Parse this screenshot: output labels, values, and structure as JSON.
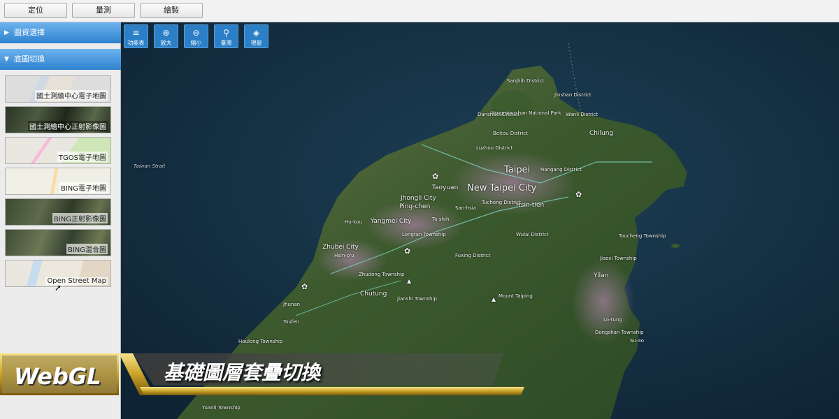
{
  "toolbar": {
    "buttons": [
      "定位",
      "量測",
      "繪製"
    ]
  },
  "sidebar": {
    "panel1": "圖資選擇",
    "panel2": "底圖切換",
    "basemaps": [
      "國土測繪中心電子地圖",
      "國土測繪中心正射影像圖",
      "TGOS電子地圖",
      "BING電子地圖",
      "BING正射影像圖",
      "BING混合圖",
      "Open Street Map"
    ]
  },
  "map_tools": [
    {
      "label": "功能表",
      "icon": "menu-icon"
    },
    {
      "label": "放大",
      "icon": "zoom-in-icon"
    },
    {
      "label": "縮小",
      "icon": "zoom-out-icon"
    },
    {
      "label": "臺灣",
      "icon": "location-pin-icon"
    },
    {
      "label": "視窗",
      "icon": "layers-icon"
    }
  ],
  "map_labels": {
    "sea": "Taiwan Strait",
    "new_taipei": "New Taipei City",
    "taipei": "Taipei",
    "keelung": "Chilung",
    "taoyuan": "Taoyuan",
    "jhongli": "Jhongli City",
    "pingzhen": "Ping-chen",
    "yangmei": "Yangmei City",
    "hukou": "Hu-kou",
    "zhubei": "Zhubei City",
    "hsinpu": "Hsin-p'u",
    "zhudong": "Zhudong Township",
    "chutung": "Chutung",
    "longtan": "Longtan Township",
    "daxi": "Ta-shih",
    "luzhou": "Luzhou District",
    "tamsui": "Danshuei District",
    "beitou": "Beitou District",
    "sanchih": "Sanjhih District",
    "jinshan": "Jinshan District",
    "wanli": "Wanli District",
    "nangang": "Nangang District",
    "xindian": "Hsin-tien",
    "tucheng": "Tucheng District",
    "sanxia": "San-hsia",
    "toucheng": "Toucheng Township",
    "jiaoxi": "Jiaoxi Township",
    "yilan": "Yilan",
    "luodong": "Lo-tung",
    "suao": "Su-ao",
    "dongshan": "Dongshan Township",
    "mt_taiping": "Mount Taiping",
    "wulai": "Wulai District",
    "fuxing": "Fuxing District",
    "jianshi": "Jianshi Township",
    "toufen": "Toufen",
    "zhunan": "Jhunan",
    "houlong": "Houlong Township",
    "yuanli": "Yuanli Township",
    "yangmingshan": "Yangmingshan National Park"
  },
  "banner": {
    "tag": "WebGL",
    "subtitle": "基礎圖層套疊切換"
  }
}
